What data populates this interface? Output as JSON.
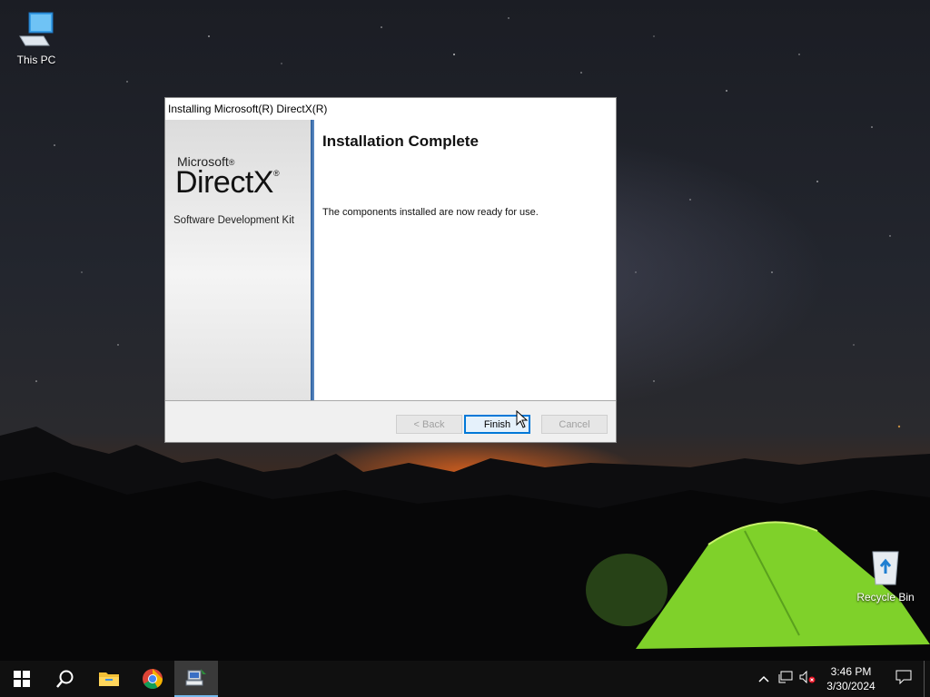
{
  "desktop": {
    "icons": [
      {
        "label": "This PC"
      },
      {
        "label": "Recycle Bin"
      }
    ]
  },
  "dialog": {
    "title": "Installing Microsoft(R) DirectX(R)",
    "brand_microsoft": "Microsoft",
    "brand_directx": "DirectX",
    "brand_reg": "®",
    "brand_subtitle": "Software Development Kit",
    "heading": "Installation Complete",
    "message": "The components installed are now ready for use.",
    "buttons": {
      "back": "< Back",
      "finish": "Finish",
      "cancel": "Cancel"
    }
  },
  "taskbar": {
    "apps": [
      "start-icon",
      "search-icon",
      "file-explorer-icon",
      "chrome-icon",
      "directx-setup-icon"
    ],
    "time": "3:46 PM",
    "date": "3/30/2024"
  },
  "colors": {
    "accent": "#0078d7",
    "taskbar": "#101010",
    "tent_green": "#7fd12a"
  }
}
